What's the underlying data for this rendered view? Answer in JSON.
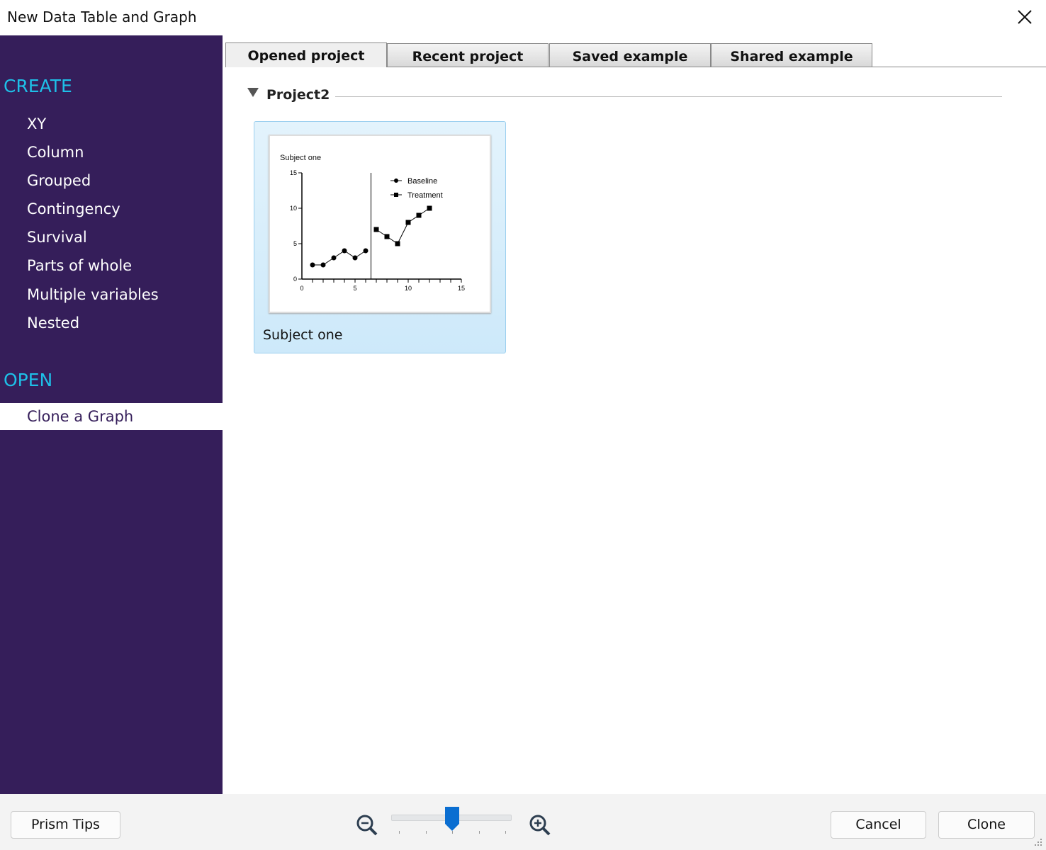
{
  "window": {
    "title": "New Data Table and Graph",
    "close_icon": "close-icon"
  },
  "sidebar": {
    "create_heading": "CREATE",
    "create_items": [
      "XY",
      "Column",
      "Grouped",
      "Contingency",
      "Survival",
      "Parts of whole",
      "Multiple variables",
      "Nested"
    ],
    "open_heading": "OPEN",
    "open_items": [
      {
        "label": "Clone a Graph",
        "selected": true
      }
    ]
  },
  "tabs": [
    {
      "label": "Opened project",
      "active": true
    },
    {
      "label": "Recent project",
      "active": false
    },
    {
      "label": "Saved example",
      "active": false
    },
    {
      "label": "Shared example",
      "active": false
    }
  ],
  "group": {
    "label": "Project2",
    "expanded": true
  },
  "card": {
    "label": "Subject one",
    "selected": true
  },
  "footer": {
    "tips_label": "Prism Tips",
    "cancel_label": "Cancel",
    "clone_label": "Clone",
    "zoom_slider": {
      "ticks": 5,
      "value_index": 2
    }
  },
  "chart_data": {
    "type": "line",
    "title": "Subject one",
    "xlabel": "",
    "ylabel": "",
    "xlim": [
      0,
      15
    ],
    "ylim": [
      0,
      15
    ],
    "xticks": [
      0,
      5,
      10,
      15
    ],
    "yticks": [
      0,
      5,
      10,
      15
    ],
    "phase_line_x": 6.5,
    "legend": "top-right",
    "series": [
      {
        "name": "Baseline",
        "marker": "circle",
        "x": [
          1,
          2,
          3,
          4,
          5,
          6
        ],
        "y": [
          2,
          2,
          3,
          4,
          3,
          4
        ]
      },
      {
        "name": "Treatment",
        "marker": "square",
        "x": [
          7,
          8,
          9,
          10,
          11,
          12
        ],
        "y": [
          7,
          6,
          5,
          8,
          9,
          10
        ]
      }
    ]
  }
}
